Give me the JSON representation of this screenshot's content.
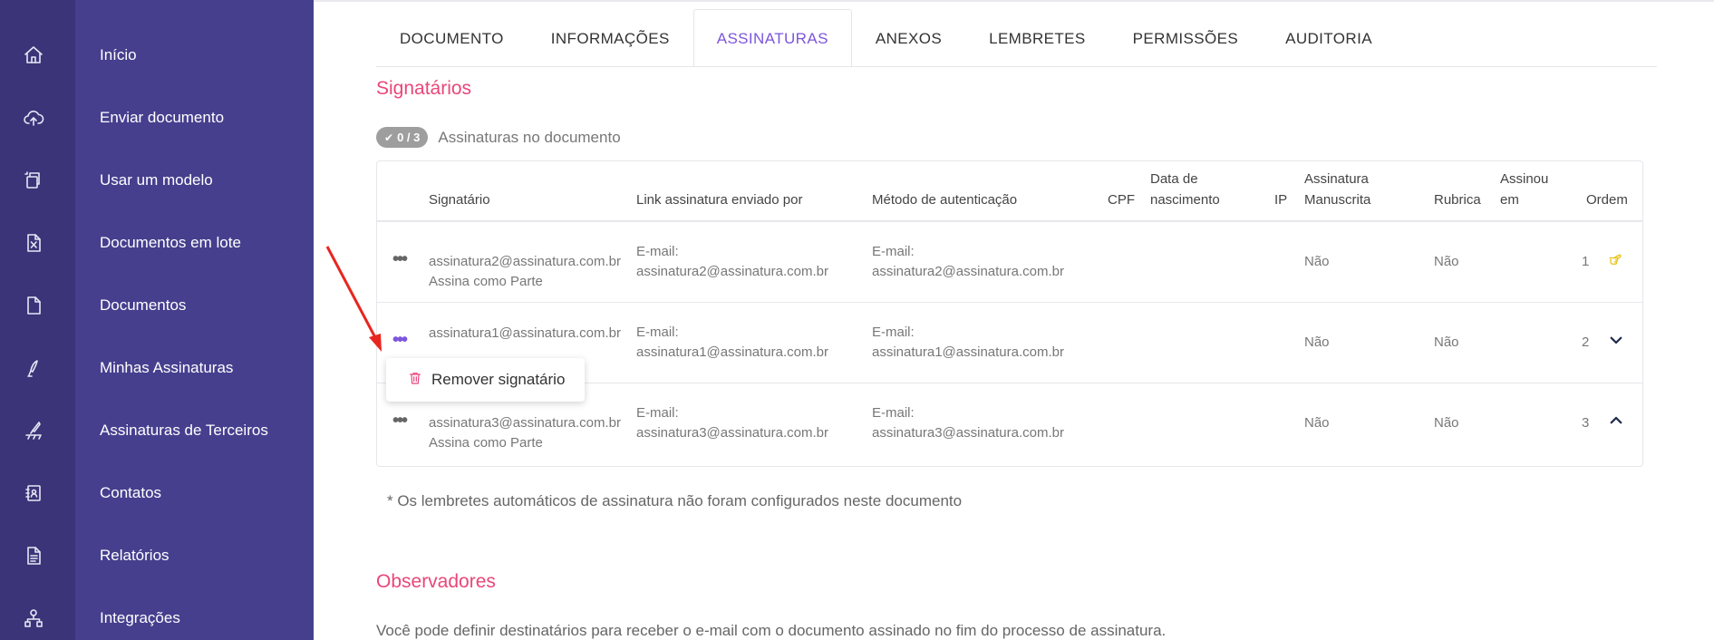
{
  "sidebar": {
    "items": [
      {
        "label": "Início",
        "icon": "home-icon"
      },
      {
        "label": "Enviar documento",
        "icon": "cloud-upload-icon"
      },
      {
        "label": "Usar um modelo",
        "icon": "template-icon"
      },
      {
        "label": "Documentos em lote",
        "icon": "spreadsheet-icon"
      },
      {
        "label": "Documentos",
        "icon": "file-icon"
      },
      {
        "label": "Minhas Assinaturas",
        "icon": "pen-icon"
      },
      {
        "label": "Assinaturas de Terceiros",
        "icon": "third-party-sign-icon"
      },
      {
        "label": "Contatos",
        "icon": "contacts-icon"
      },
      {
        "label": "Relatórios",
        "icon": "report-icon"
      },
      {
        "label": "Integrações",
        "icon": "integrations-icon"
      }
    ]
  },
  "tabs": [
    {
      "label": "DOCUMENTO"
    },
    {
      "label": "INFORMAÇÕES"
    },
    {
      "label": "ASSINATURAS",
      "active": true
    },
    {
      "label": "ANEXOS"
    },
    {
      "label": "LEMBRETES"
    },
    {
      "label": "PERMISSÕES"
    },
    {
      "label": "AUDITORIA"
    }
  ],
  "signatories": {
    "title": "Signatários",
    "badge": "0 / 3",
    "badge_label": "Assinaturas no documento",
    "columns": {
      "signatario": "Signatário",
      "link": "Link assinatura enviado por",
      "metodo": "Método de autenticação",
      "cpf": "CPF",
      "nascimento_1": "Data de",
      "nascimento_2": "nascimento",
      "ip": "IP",
      "manuscrita_1": "Assinatura",
      "manuscrita_2": "Manuscrita",
      "rubrica": "Rubrica",
      "assinou_1": "Assinou",
      "assinou_2": "em",
      "ordem": "Ordem"
    },
    "rows": [
      {
        "email": "assinatura2@assinatura.com.br",
        "role": "Assina como Parte",
        "link_type": "E-mail:",
        "link_email": "assinatura2@assinatura.com.br",
        "auth_type": "E-mail:",
        "auth_email": "assinatura2@assinatura.com.br",
        "manuscrita": "Não",
        "rubrica": "Não",
        "ordem": "1",
        "order_icon": "pointing-hand-icon"
      },
      {
        "email": "assinatura1@assinatura.com.br",
        "role": "",
        "link_type": "E-mail:",
        "link_email": "assinatura1@assinatura.com.br",
        "auth_type": "E-mail:",
        "auth_email": "assinatura1@assinatura.com.br",
        "manuscrita": "Não",
        "rubrica": "Não",
        "ordem": "2",
        "order_icon": "chevron-down-icon"
      },
      {
        "email": "assinatura3@assinatura.com.br",
        "role": "Assina como Parte",
        "link_type": "E-mail:",
        "link_email": "assinatura3@assinatura.com.br",
        "auth_type": "E-mail:",
        "auth_email": "assinatura3@assinatura.com.br",
        "manuscrita": "Não",
        "rubrica": "Não",
        "ordem": "3",
        "order_icon": "chevron-up-icon"
      }
    ],
    "popup_label": "Remover signatário",
    "note": "* Os lembretes automáticos de assinatura não foram configurados neste documento"
  },
  "observers": {
    "title": "Observadores",
    "description": "Você pode definir destinatários para receber o e-mail com o documento assinado no fim do processo de assinatura."
  },
  "colors": {
    "sidebar_dark": "#3b3478",
    "sidebar": "#463f8e",
    "accent_purple": "#7d55dd",
    "accent_pink": "#e9467a",
    "annotation_arrow": "#e8261f",
    "order_hand": "#e8c21a",
    "order_chevron": "#1f2a4d"
  }
}
